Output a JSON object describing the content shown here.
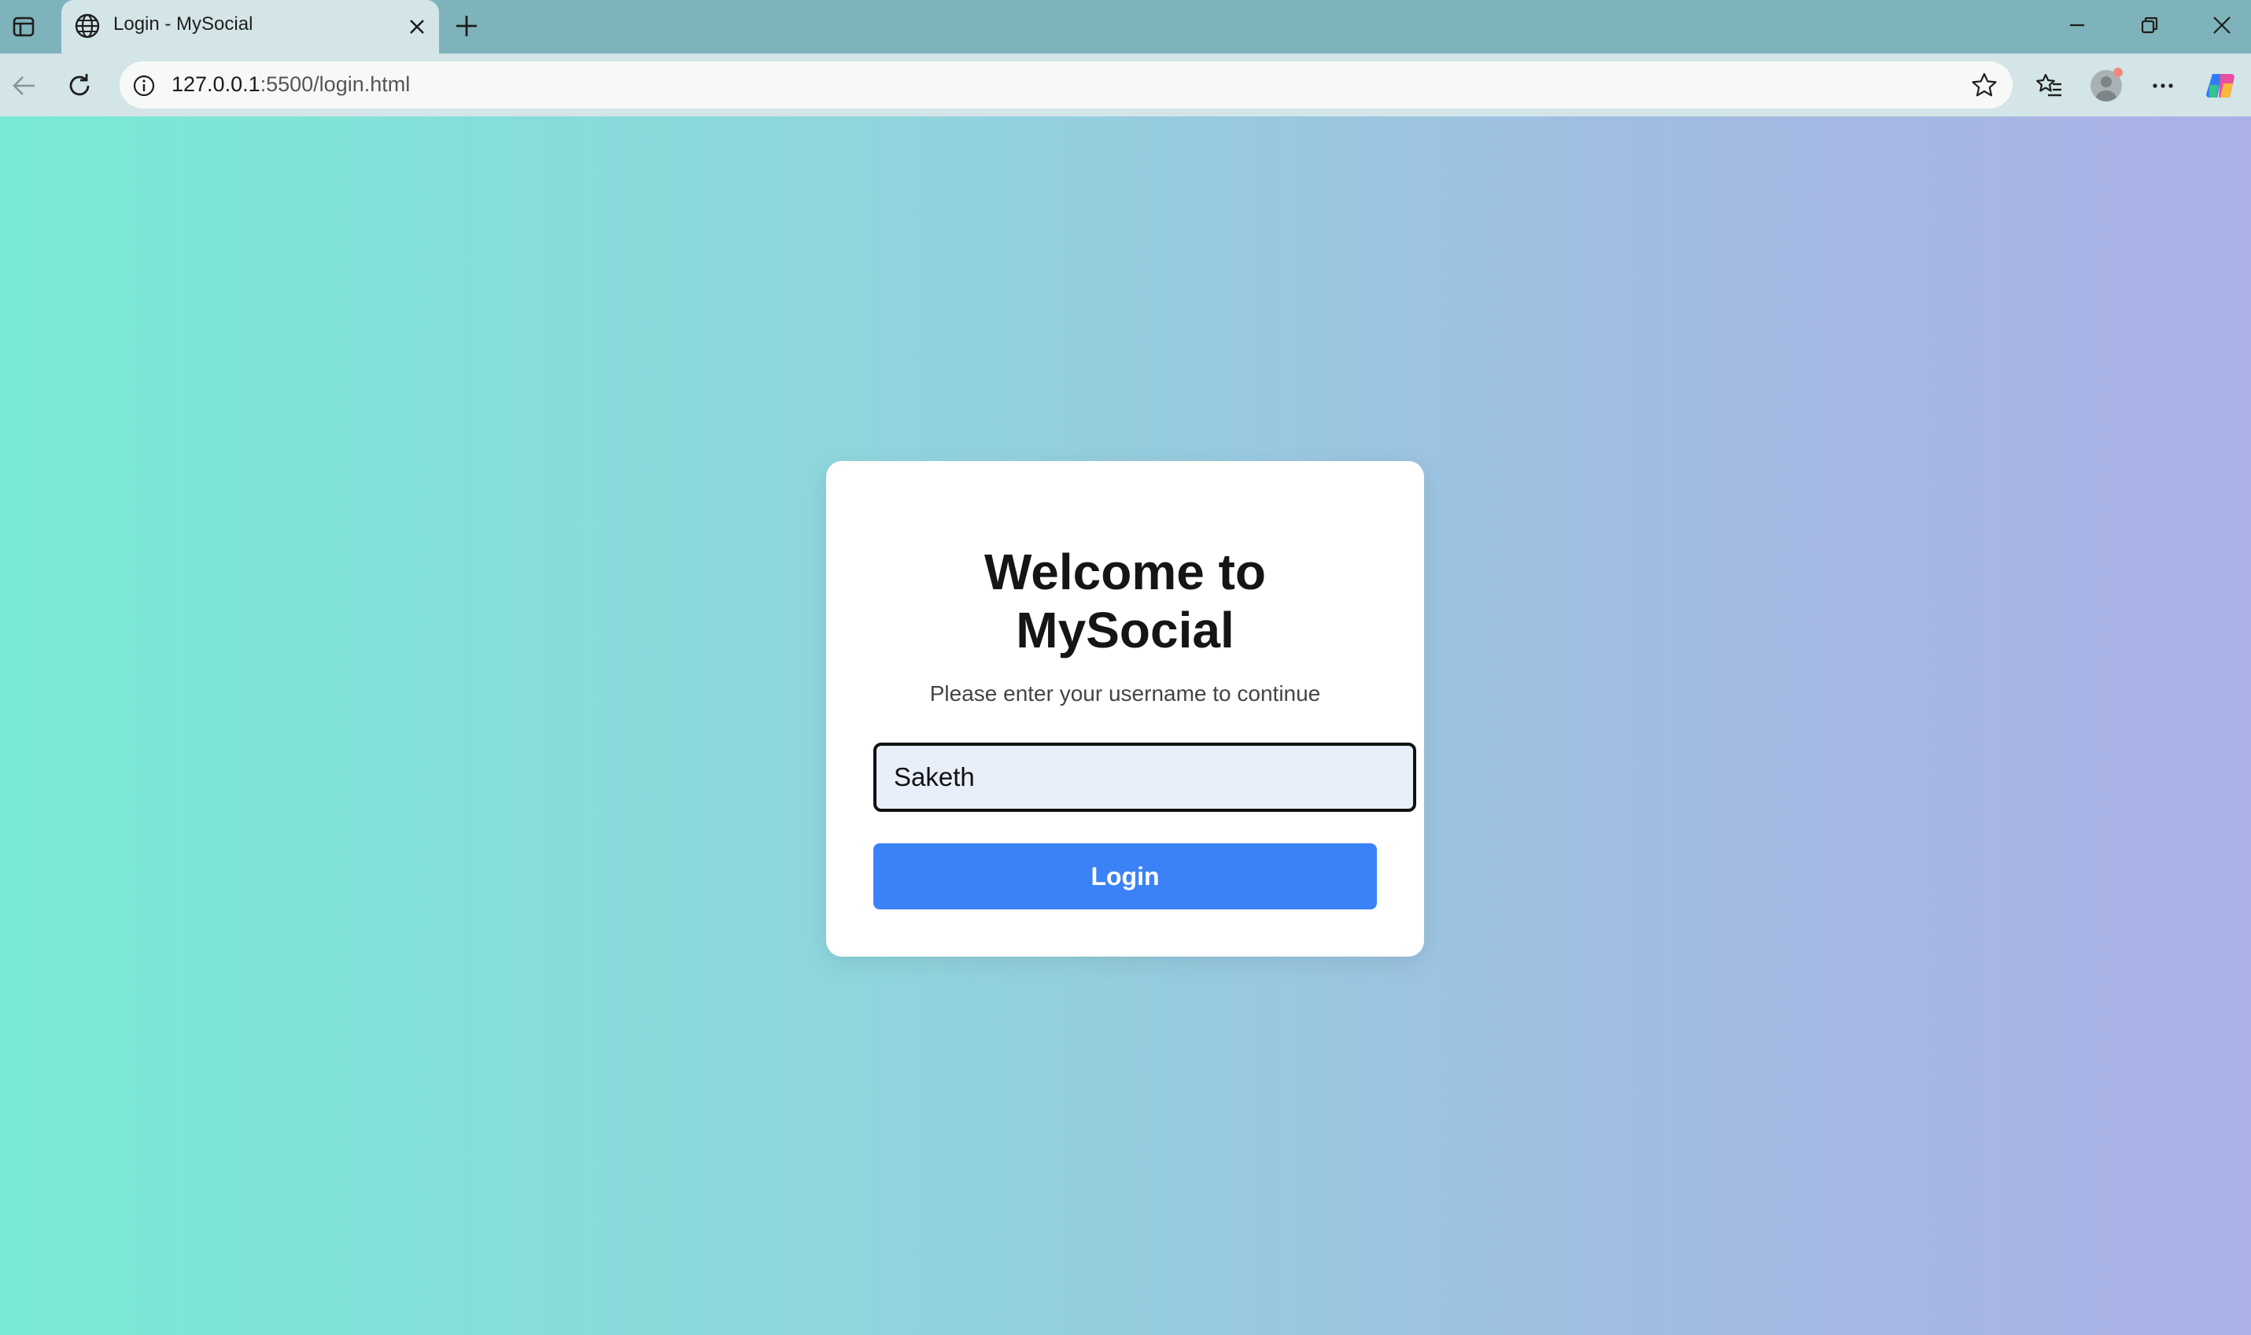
{
  "browser": {
    "tab": {
      "title": "Login - MySocial",
      "favicon": "globe-icon"
    },
    "new_tab_icon": "plus-icon",
    "address_bar": {
      "host": "127.0.0.1",
      "rest": ":5500/login.html"
    },
    "toolbar_icons": [
      "back-arrow-icon",
      "reload-icon",
      "site-info-icon",
      "star-icon",
      "favorites-icon",
      "profile-avatar",
      "more-icon",
      "copilot-icon"
    ]
  },
  "page": {
    "background_gradient": [
      "#78ead4",
      "#abb1e6"
    ],
    "card": {
      "title_line1": "Welcome to",
      "title_line2": "MySocial",
      "subtitle": "Please enter your username to continue",
      "username_value": "Saketh",
      "login_label": "Login",
      "button_color": "#3b82f6"
    }
  }
}
